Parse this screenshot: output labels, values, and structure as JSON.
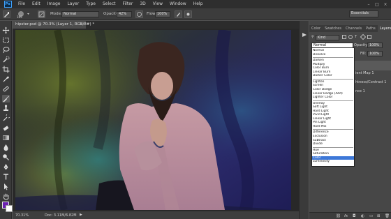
{
  "menubar": {
    "logo": "Ps",
    "items": [
      "File",
      "Edit",
      "Image",
      "Layer",
      "Type",
      "Select",
      "Filter",
      "3D",
      "View",
      "Window",
      "Help"
    ],
    "window_controls": [
      "–",
      "□",
      "×"
    ]
  },
  "options": {
    "brush_size": "165",
    "mode_label": "Mode:",
    "mode_value": "Normal",
    "opacity_label": "Opacity:",
    "opacity_value": "42%",
    "flow_label": "Flow:",
    "flow_value": "100%",
    "workspace": "Essentials"
  },
  "document": {
    "tab_title": "hipster.psd @ 70.3% (Layer 1, RGB/8#) *",
    "zoom": "70.31%",
    "doc_size": "Doc: 3.11M/6.82M"
  },
  "panel": {
    "tabs": [
      "Color",
      "Swatches",
      "Channels",
      "Paths",
      "Layers"
    ],
    "active_tab": "Layers",
    "kind_label": "Kind",
    "blend_selected": "Normal",
    "opacity_label": "Opacity:",
    "opacity_value": "100%",
    "fill_label": "Fill:",
    "fill_value": "100%",
    "layer_labels": [
      "ient Map 1",
      "htness/Contrast 1",
      "nce 1"
    ],
    "blend_modes": [
      "Normal",
      "Dissolve",
      "Darken",
      "Multiply",
      "Color Burn",
      "Linear Burn",
      "Darker Color",
      "Lighten",
      "Screen",
      "Color Dodge",
      "Linear Dodge (Add)",
      "Lighter Color",
      "Overlay",
      "Soft Light",
      "Hard Light",
      "Vivid Light",
      "Linear Light",
      "Pin Light",
      "Hard Mix",
      "Difference",
      "Exclusion",
      "Subtract",
      "Divide",
      "Hue",
      "Saturation",
      "Color",
      "Luminosity"
    ],
    "highlighted_mode": "Color",
    "bottom_icons": [
      "link-icon",
      "fx-icon",
      "mask-icon",
      "adjustment-icon",
      "group-icon",
      "new-layer-icon",
      "trash-icon"
    ]
  },
  "colors": {
    "foreground": "#6a1fb0",
    "background": "#ffffff",
    "highlight": "#3d78d8"
  }
}
